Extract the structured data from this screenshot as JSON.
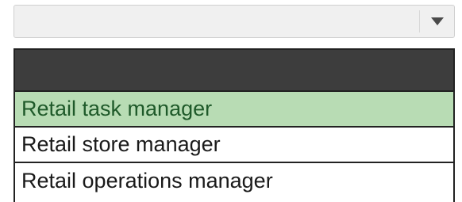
{
  "combobox": {
    "value": "",
    "arrow_icon": "caret-down-icon"
  },
  "dropdown": {
    "options": [
      {
        "label": "Retail task manager",
        "selected": true
      },
      {
        "label": "Retail store manager",
        "selected": false
      },
      {
        "label": "Retail operations manager",
        "selected": false
      }
    ]
  },
  "colors": {
    "selected_background": "#b8dcb4",
    "selected_text": "#1f5a2a",
    "header_background": "#3d3d3d"
  }
}
